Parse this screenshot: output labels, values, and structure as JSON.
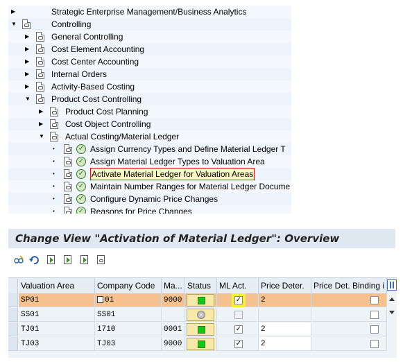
{
  "tree": {
    "nodes": [
      {
        "label": "Strategic Enterprise Management/Business Analytics",
        "expander": "collapsed",
        "icon": "none",
        "indent": 0
      },
      {
        "label": "Controlling",
        "expander": "expanded",
        "icon": "document-icon",
        "indent": 0
      },
      {
        "label": "General Controlling",
        "expander": "collapsed",
        "icon": "document-icon",
        "indent": 1
      },
      {
        "label": "Cost Element Accounting",
        "expander": "collapsed",
        "icon": "document-icon",
        "indent": 1
      },
      {
        "label": "Cost Center Accounting",
        "expander": "collapsed",
        "icon": "document-icon",
        "indent": 1
      },
      {
        "label": "Internal Orders",
        "expander": "collapsed",
        "icon": "document-icon",
        "indent": 1
      },
      {
        "label": "Activity-Based Costing",
        "expander": "collapsed",
        "icon": "document-icon",
        "indent": 1
      },
      {
        "label": "Product Cost Controlling",
        "expander": "expanded",
        "icon": "document-icon",
        "indent": 1
      },
      {
        "label": "Product Cost Planning",
        "expander": "collapsed",
        "icon": "document-icon",
        "indent": 2
      },
      {
        "label": "Cost Object Controlling",
        "expander": "collapsed",
        "icon": "document-icon",
        "indent": 2
      },
      {
        "label": "Actual Costing/Material Ledger",
        "expander": "expanded",
        "icon": "document-icon",
        "indent": 2
      },
      {
        "label": "Assign Currency Types and Define Material Ledger T",
        "expander": "leaf",
        "icon": "execute-icon",
        "indent": 3
      },
      {
        "label": "Assign Material Ledger Types to Valuation Area",
        "expander": "leaf",
        "icon": "execute-icon",
        "indent": 3
      },
      {
        "label": "Activate Material Ledger for Valuation Areas",
        "expander": "leaf",
        "icon": "execute-icon",
        "indent": 3,
        "highlighted": true
      },
      {
        "label": "Maintain Number Ranges for Material Ledger Docume",
        "expander": "leaf",
        "icon": "execute-icon",
        "indent": 3
      },
      {
        "label": "Configure Dynamic Price Changes",
        "expander": "leaf",
        "icon": "execute-icon",
        "indent": 3
      },
      {
        "label": "Reasons for Price Changes",
        "expander": "leaf",
        "icon": "execute-icon",
        "indent": 3
      }
    ]
  },
  "view": {
    "title": "Change View \"Activation of Material Ledger\": Overview",
    "toolbar_icons": [
      "glasses-display-change-icon",
      "undo-icon",
      "copy-entry-icon",
      "new-entries-icon",
      "delete-icon",
      "document-icon"
    ]
  },
  "table": {
    "headers": [
      "Valuation Area",
      "Company Code",
      "Ma...",
      "Status",
      "ML Act.",
      "Price Deter.",
      "Price Det. Binding i"
    ],
    "rows": [
      {
        "valuation_area": "SP01",
        "company_code": "01",
        "ma": "9000",
        "status": "active",
        "ml_act": true,
        "price_det": "2",
        "binding": false,
        "selected": true
      },
      {
        "valuation_area": "SS01",
        "company_code": "SS01",
        "ma": "",
        "status": "inactive",
        "ml_act": false,
        "price_det": "",
        "binding": false,
        "selected": false
      },
      {
        "valuation_area": "TJ01",
        "company_code": "1710",
        "ma": "0001",
        "status": "active",
        "ml_act": true,
        "price_det": "2",
        "binding": false,
        "selected": false
      },
      {
        "valuation_area": "TJ03",
        "company_code": "TJ03",
        "ma": "9000",
        "status": "active",
        "ml_act": true,
        "price_det": "2",
        "binding": false,
        "selected": false
      }
    ]
  },
  "colors": {
    "status_green": "#14c514",
    "selected_row": "#f5c28f",
    "highlight_yellow": "#f3ee3a",
    "highlight_border": "#e01010"
  }
}
